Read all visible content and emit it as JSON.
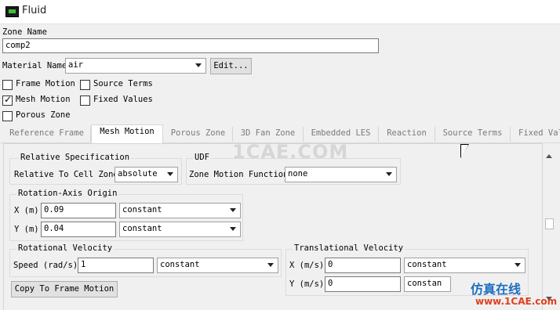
{
  "window": {
    "title": "Fluid"
  },
  "zone_name": {
    "label": "Zone Name",
    "value": "comp2"
  },
  "material": {
    "label": "Material Name",
    "value": "air",
    "edit_label": "Edit..."
  },
  "checkboxes": {
    "frame_motion": {
      "label": "Frame Motion",
      "checked": false
    },
    "source_terms": {
      "label": "Source Terms",
      "checked": false
    },
    "mesh_motion": {
      "label": "Mesh Motion",
      "checked": true
    },
    "fixed_values": {
      "label": "Fixed Values",
      "checked": false
    },
    "porous_zone": {
      "label": "Porous Zone",
      "checked": false
    }
  },
  "tabs": [
    "Reference Frame",
    "Mesh Motion",
    "Porous Zone",
    "3D Fan Zone",
    "Embedded LES",
    "Reaction",
    "Source Terms",
    "Fixed Val"
  ],
  "active_tab": 1,
  "relative_spec": {
    "title": "Relative Specification",
    "label": "Relative To Cell Zone",
    "value": "absolute"
  },
  "udf": {
    "title": "UDF",
    "label": "Zone Motion Function",
    "value": "none"
  },
  "rotation_axis": {
    "title": "Rotation-Axis Origin",
    "x": {
      "label": "X (m)",
      "value": "0.09",
      "mode": "constant"
    },
    "y": {
      "label": "Y (m)",
      "value": "0.04",
      "mode": "constant"
    }
  },
  "rotational_velocity": {
    "title": "Rotational Velocity",
    "label": "Speed (rad/s)",
    "value": "1",
    "mode": "constant"
  },
  "translational_velocity": {
    "title": "Translational Velocity",
    "x": {
      "label": "X (m/s)",
      "value": "0",
      "mode": "constant"
    },
    "y": {
      "label": "Y (m/s)",
      "value": "0",
      "mode": "constan"
    }
  },
  "copy_button": "Copy To Frame Motion",
  "watermarks": {
    "center": "1CAE.COM",
    "corner_cn": "仿真在线",
    "corner_url": "www.1CAE.com"
  }
}
